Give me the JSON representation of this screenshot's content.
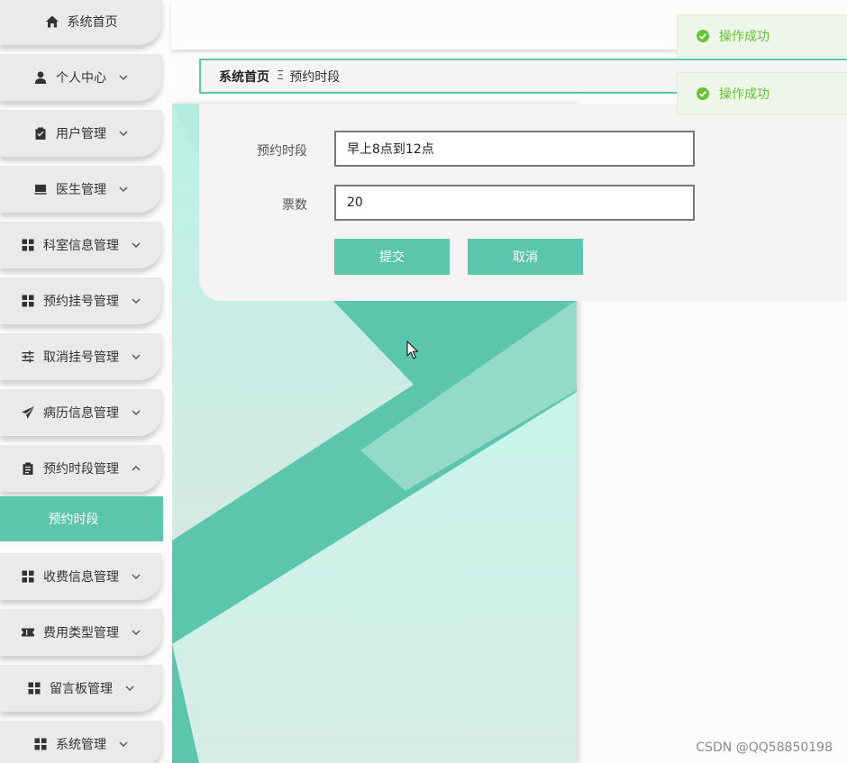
{
  "sidebar": {
    "items": [
      {
        "label": "系统首页",
        "icon": "home-icon"
      },
      {
        "label": "个人中心",
        "icon": "user-icon",
        "chevron": "down"
      },
      {
        "label": "用户管理",
        "icon": "clipboard-check-icon",
        "chevron": "down"
      },
      {
        "label": "医生管理",
        "icon": "monitor-icon",
        "chevron": "down"
      },
      {
        "label": "科室信息管理",
        "icon": "grid-icon",
        "chevron": "down"
      },
      {
        "label": "预约挂号管理",
        "icon": "grid-icon",
        "chevron": "down"
      },
      {
        "label": "取消挂号管理",
        "icon": "sliders-icon",
        "chevron": "down"
      },
      {
        "label": "病历信息管理",
        "icon": "paper-plane-icon",
        "chevron": "down"
      },
      {
        "label": "预约时段管理",
        "icon": "clipboard-icon",
        "chevron": "up"
      },
      {
        "label": "收费信息管理",
        "icon": "grid-icon",
        "chevron": "down"
      },
      {
        "label": "费用类型管理",
        "icon": "ticket-icon",
        "chevron": "down"
      },
      {
        "label": "留言板管理",
        "icon": "grid-icon",
        "chevron": "down"
      },
      {
        "label": "系统管理",
        "icon": "grid-icon",
        "chevron": "down"
      }
    ],
    "active_sub": "预约时段"
  },
  "breadcrumb": {
    "home": "系统首页",
    "separator": "Ξ",
    "current": "预约时段"
  },
  "form": {
    "period_label": "预约时段",
    "period_value": "早上8点到12点",
    "tickets_label": "票数",
    "tickets_value": "20",
    "submit_label": "提交",
    "cancel_label": "取消"
  },
  "toasts": [
    {
      "message": "操作成功",
      "type": "success"
    },
    {
      "message": "操作成功",
      "type": "success"
    }
  ],
  "watermark": "CSDN @QQ58850198",
  "colors": {
    "accent": "#5cc5ad",
    "success": "#67c23a",
    "toast_bg": "#eef6ea",
    "sidebar_item_bg": "#eaeae9"
  }
}
